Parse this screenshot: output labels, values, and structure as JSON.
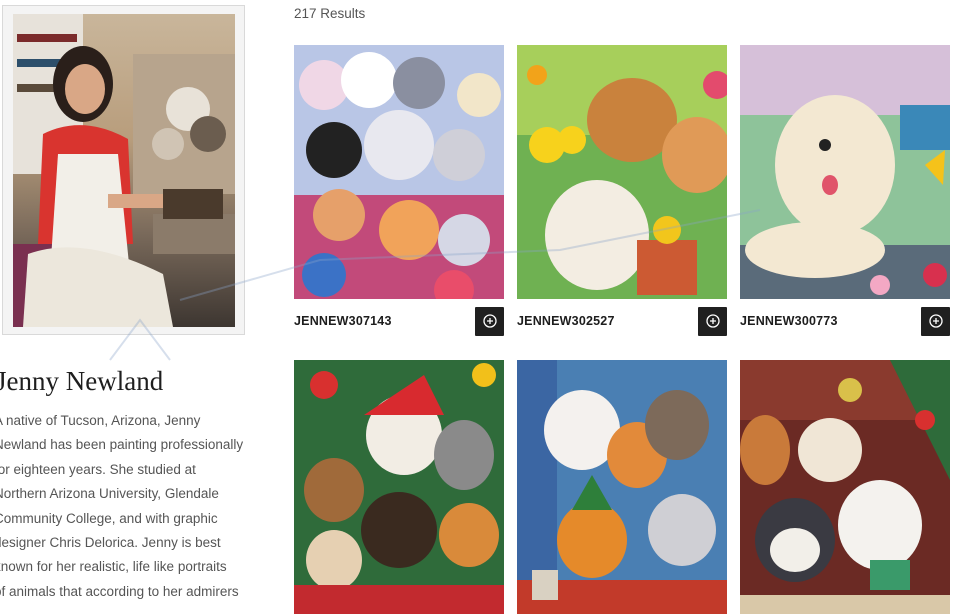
{
  "results": {
    "count_text": "217 Results"
  },
  "artist": {
    "name": "Jenny Newland",
    "bio_lines": [
      "A native of Tucson, Arizona, Jenny",
      "Newland has been painting professionally",
      "for eighteen years. She studied at",
      "Northern Arizona University, Glendale",
      "Community College, and with graphic",
      "designer Chris Delorica. Jenny is best",
      "known for her realistic, life like portraits",
      "of animals that according to her admirers"
    ]
  },
  "products": [
    {
      "sku": "JENNEW307143",
      "icon": "add-circle-icon"
    },
    {
      "sku": "JENNEW302527",
      "icon": "add-circle-icon"
    },
    {
      "sku": "JENNEW300773",
      "icon": "add-circle-icon"
    },
    {
      "sku": "",
      "icon": ""
    },
    {
      "sku": "",
      "icon": ""
    },
    {
      "sku": "",
      "icon": ""
    }
  ],
  "colors": {
    "button_bg": "#202020",
    "accent_watermark": "#8aa4c8"
  }
}
